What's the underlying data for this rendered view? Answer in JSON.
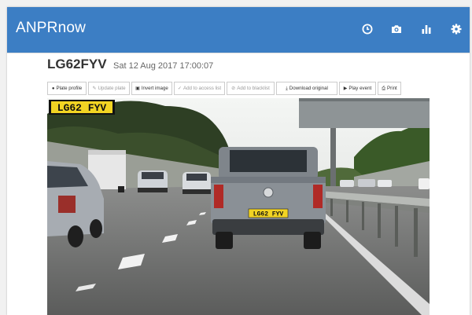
{
  "app": {
    "brand": "ANPRnow"
  },
  "nav_icons": [
    {
      "name": "clock-icon"
    },
    {
      "name": "camera-icon"
    },
    {
      "name": "bar-chart-icon"
    },
    {
      "name": "gear-icon"
    }
  ],
  "event": {
    "plate": "LG62FYV",
    "timestamp": "Sat 12 Aug 2017 17:00:07"
  },
  "toolbar": {
    "plate_profile": "Plate profile",
    "update_plate": "Update plate",
    "invert_image": "Invert image",
    "add_access_list": "Add to access list",
    "add_blacklist": "Add to blacklist",
    "download_original": "Download original",
    "play_event": "Play event",
    "print": "Print"
  },
  "image": {
    "overlay_plate": "LG62 FYV",
    "vehicle_plate": "LG62 FYV"
  },
  "colors": {
    "navbar": "#3c7ec4",
    "plate_yellow": "#f2d423"
  }
}
